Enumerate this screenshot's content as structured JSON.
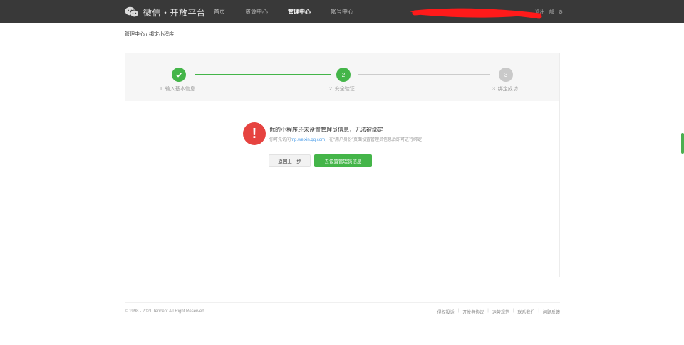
{
  "header": {
    "brand": "微信・开放平台",
    "nav": [
      "首页",
      "资源中心",
      "管理中心",
      "帐号中心"
    ],
    "active_nav": "管理中心",
    "user_area": [
      "退出",
      "部"
    ]
  },
  "breadcrumb": {
    "parent": "管理中心",
    "separator": "/",
    "current": "绑定小程序"
  },
  "steps": [
    {
      "number": "1",
      "label": "1. 输入基本信息",
      "status": "done"
    },
    {
      "number": "2",
      "label": "2. 安全验证",
      "status": "active"
    },
    {
      "number": "3",
      "label": "3. 绑定成功",
      "status": "pending"
    }
  ],
  "alert": {
    "icon": "!",
    "title": "你的小程序还未设置管理员信息，无法被绑定",
    "desc_prefix": "你可先访问",
    "desc_link": "mp.weixin.qq.com",
    "desc_suffix": "，在“用户身份”页面设置管理员信息后即可进行绑定"
  },
  "buttons": {
    "back": "返回上一步",
    "go": "去设置管理员信息"
  },
  "footer": {
    "copyright": "© 1998 - 2021 Tencent All Right Reserved",
    "links": [
      "侵权投诉",
      "开发者协议",
      "运营规范",
      "联系我们",
      "问题反馈"
    ]
  },
  "colors": {
    "topbar": "#393939",
    "accent_green": "#44b549",
    "alert_red": "#e64340",
    "link_blue": "#459ae9"
  }
}
